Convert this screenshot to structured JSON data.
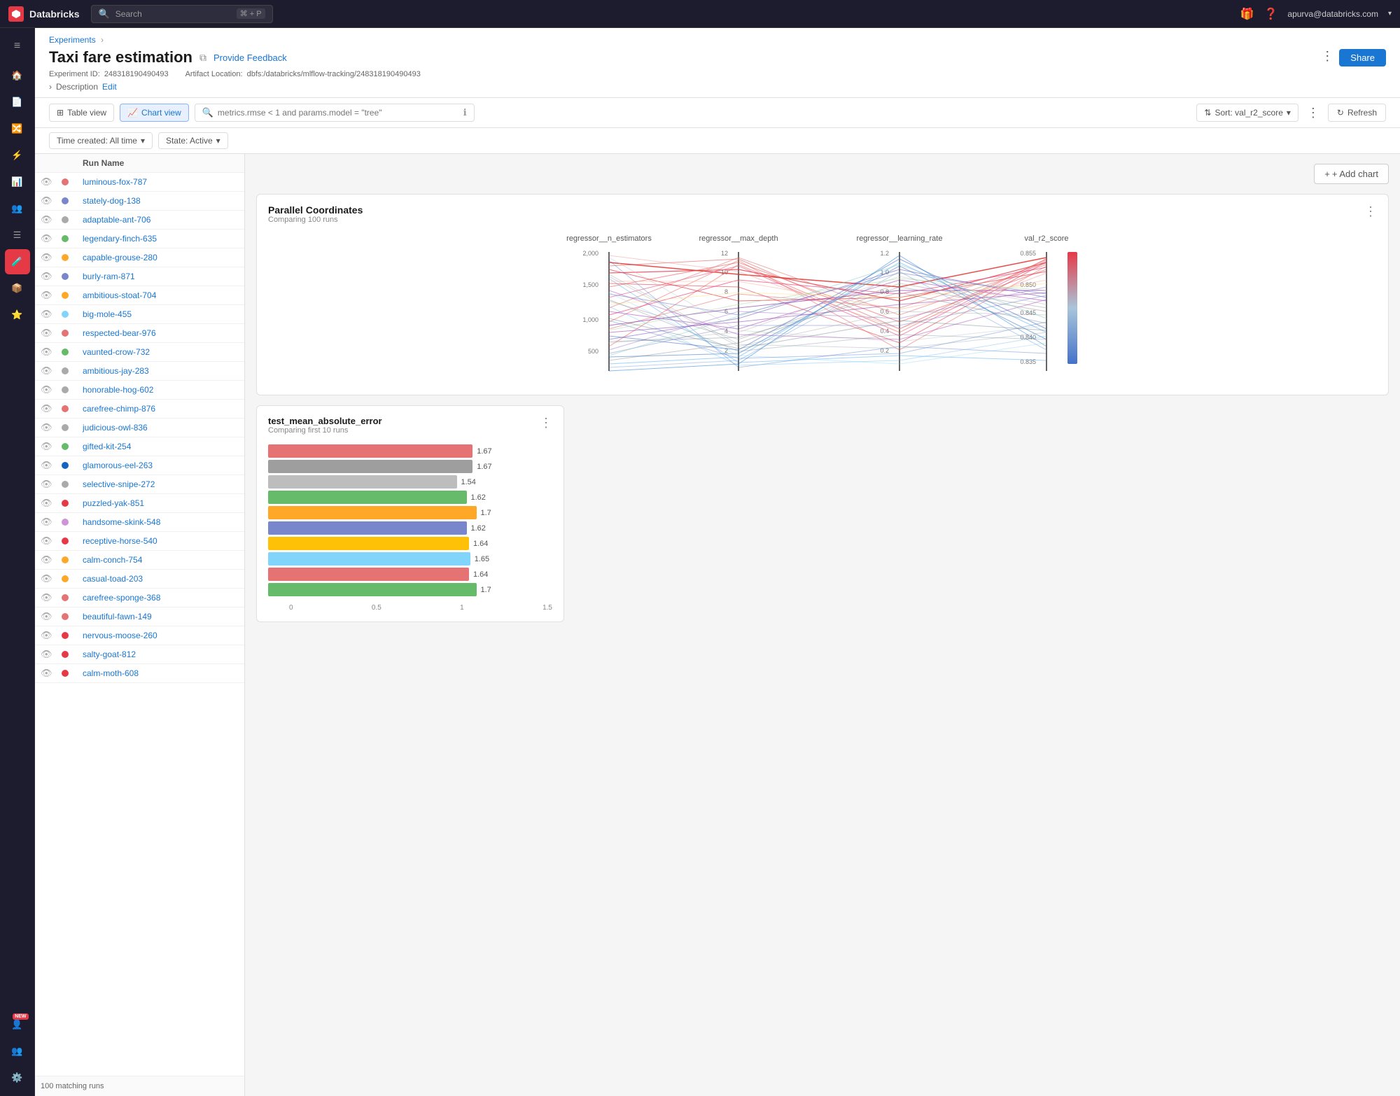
{
  "topbar": {
    "logo": "Databricks",
    "search_placeholder": "Search",
    "shortcut": "⌘ + P",
    "user": "apurva@databricks.com"
  },
  "breadcrumb": {
    "label": "Experiments",
    "separator": "›"
  },
  "page": {
    "title": "Taxi fare estimation",
    "feedback_link": "Provide Feedback",
    "experiment_id_label": "Experiment ID:",
    "experiment_id": "248318190490493",
    "artifact_label": "Artifact Location:",
    "artifact_path": "dbfs:/databricks/mlflow-tracking/248318190490493",
    "description_label": "Description",
    "description_edit": "Edit"
  },
  "toolbar": {
    "table_view": "Table view",
    "chart_view": "Chart view",
    "search_placeholder": "metrics.rmse < 1 and params.model = \"tree\"",
    "sort_label": "Sort: val_r2_score",
    "more_icon": "⋮",
    "refresh_label": "Refresh"
  },
  "filters": {
    "time_created": "Time created: All time",
    "state": "State: Active"
  },
  "runs": {
    "header": "Run Name",
    "footer": "100 matching runs",
    "items": [
      {
        "name": "luminous-fox-787",
        "color": "#e57373"
      },
      {
        "name": "stately-dog-138",
        "color": "#7986cb"
      },
      {
        "name": "adaptable-ant-706",
        "color": "#aaa"
      },
      {
        "name": "legendary-finch-635",
        "color": "#66bb6a"
      },
      {
        "name": "capable-grouse-280",
        "color": "#ffa726"
      },
      {
        "name": "burly-ram-871",
        "color": "#7986cb"
      },
      {
        "name": "ambitious-stoat-704",
        "color": "#ffa726"
      },
      {
        "name": "big-mole-455",
        "color": "#81d4fa"
      },
      {
        "name": "respected-bear-976",
        "color": "#e57373"
      },
      {
        "name": "vaunted-crow-732",
        "color": "#66bb6a"
      },
      {
        "name": "ambitious-jay-283",
        "color": "#aaa"
      },
      {
        "name": "honorable-hog-602",
        "color": "#aaa"
      },
      {
        "name": "carefree-chimp-876",
        "color": "#e57373"
      },
      {
        "name": "judicious-owl-836",
        "color": "#aaa"
      },
      {
        "name": "gifted-kit-254",
        "color": "#66bb6a"
      },
      {
        "name": "glamorous-eel-263",
        "color": "#1565c0"
      },
      {
        "name": "selective-snipe-272",
        "color": "#aaa"
      },
      {
        "name": "puzzled-yak-851",
        "color": "#e63946"
      },
      {
        "name": "handsome-skink-548",
        "color": "#ce93d8"
      },
      {
        "name": "receptive-horse-540",
        "color": "#e63946"
      },
      {
        "name": "calm-conch-754",
        "color": "#ffa726"
      },
      {
        "name": "casual-toad-203",
        "color": "#ffa726"
      },
      {
        "name": "carefree-sponge-368",
        "color": "#e57373"
      },
      {
        "name": "beautiful-fawn-149",
        "color": "#e57373"
      },
      {
        "name": "nervous-moose-260",
        "color": "#e63946"
      },
      {
        "name": "salty-goat-812",
        "color": "#e63946"
      },
      {
        "name": "calm-moth-608",
        "color": "#e63946"
      }
    ]
  },
  "parallel_chart": {
    "title": "Parallel Coordinates",
    "subtitle": "Comparing 100 runs",
    "columns": [
      "regressor__n_estimators",
      "regressor__max_depth",
      "regressor__learning_rate",
      "val_r2_score"
    ],
    "y_labels_col1": [
      "2,000",
      "1,500",
      "1,000",
      "500"
    ],
    "y_labels_col2": [
      "12",
      "10",
      "8",
      "6",
      "4",
      "2"
    ],
    "y_labels_col3": [
      "1.2",
      "1.0",
      "0.8",
      "0.6",
      "0.4",
      "0.2"
    ],
    "y_labels_col4": [
      "0.855",
      "0.850",
      "0.845",
      "0.840",
      "0.835"
    ]
  },
  "bar_chart": {
    "title": "test_mean_absolute_error",
    "subtitle": "Comparing first 10 runs",
    "x_labels": [
      "0",
      "0.5",
      "1",
      "1.5"
    ],
    "bars": [
      {
        "value": 1.67,
        "color": "#e57373",
        "width_pct": 93
      },
      {
        "value": 1.67,
        "color": "#9e9e9e",
        "width_pct": 93
      },
      {
        "value": 1.54,
        "color": "#bdbdbd",
        "width_pct": 86
      },
      {
        "value": 1.62,
        "color": "#66bb6a",
        "width_pct": 90
      },
      {
        "value": 1.7,
        "color": "#ffa726",
        "width_pct": 95
      },
      {
        "value": 1.62,
        "color": "#7986cb",
        "width_pct": 90
      },
      {
        "value": 1.64,
        "color": "#ffc107",
        "width_pct": 91
      },
      {
        "value": 1.65,
        "color": "#81d4fa",
        "width_pct": 92
      },
      {
        "value": 1.64,
        "color": "#e57373",
        "width_pct": 91
      },
      {
        "value": 1.7,
        "color": "#66bb6a",
        "width_pct": 95
      }
    ]
  },
  "add_chart": "+ Add chart",
  "legend_values": [
    "0.855",
    "0.850",
    "0.845",
    "0.840",
    "0.835"
  ]
}
